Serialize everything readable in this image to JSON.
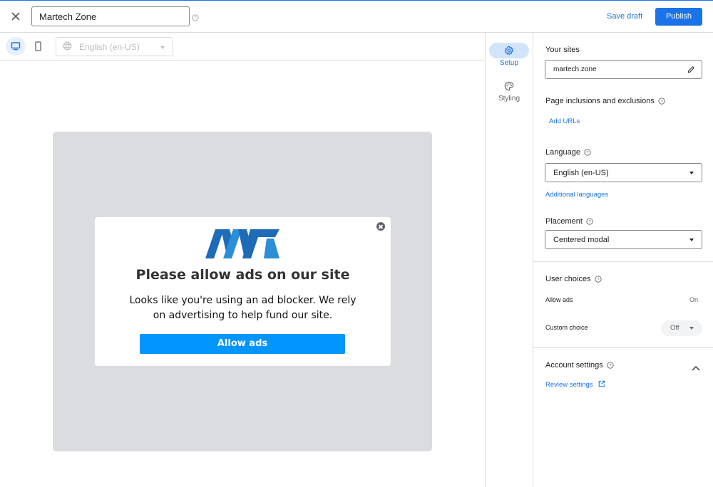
{
  "topbar": {
    "close_icon": "close-icon",
    "name_value": "Martech Zone",
    "help_icon": "help-circle-icon",
    "save_draft_label": "Save draft",
    "publish_label": "Publish"
  },
  "preview_toolbar": {
    "desktop_icon": "desktop-icon",
    "mobile_icon": "mobile-icon",
    "language_icon": "globe-icon",
    "language_value": "English (en-US)"
  },
  "modal": {
    "logo": "MT",
    "title": "Please allow ads on our site",
    "body": "Looks like you're using an ad blocker. We rely on advertising to help fund our site.",
    "button_label": "Allow ads",
    "close_icon": "close-circle-icon"
  },
  "rail": {
    "items": [
      {
        "label": "Setup",
        "icon": "gear-icon"
      },
      {
        "label": "Styling",
        "icon": "palette-icon"
      }
    ]
  },
  "panel": {
    "your_sites": {
      "title": "Your sites",
      "value": "martech.zone",
      "edit_icon": "pencil-icon"
    },
    "inclusions": {
      "title": "Page inclusions and exclusions",
      "link": "Add URLs"
    },
    "language": {
      "title": "Language",
      "value": "English (en-US)",
      "link": "Additional languages"
    },
    "placement": {
      "title": "Placement",
      "value": "Centered modal"
    },
    "user_choices": {
      "title": "User choices",
      "allow_label": "Allow ads",
      "allow_value": "On",
      "custom_label": "Custom choice",
      "custom_value": "Off"
    },
    "account_settings": {
      "title": "Account settings",
      "link": "Review settings",
      "external_icon": "open-in-new-icon"
    }
  },
  "colors": {
    "accent": "#1a73e8",
    "modal_button": "#0095ff",
    "canvas": "#dadce0",
    "logo_blue": "#1e6bb8"
  }
}
